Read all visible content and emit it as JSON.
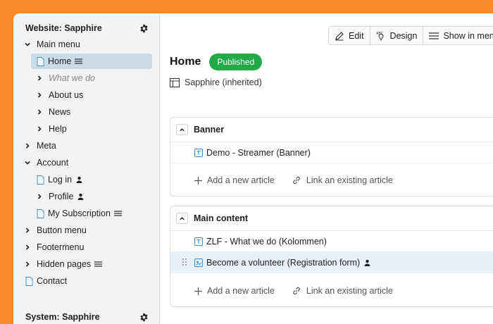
{
  "sidebar": {
    "website_title": "Website: Sapphire",
    "system_title": "System: Sapphire",
    "items": [
      {
        "label": "Main menu"
      },
      {
        "label": "Home"
      },
      {
        "label": "What we do"
      },
      {
        "label": "About us"
      },
      {
        "label": "News"
      },
      {
        "label": "Help"
      },
      {
        "label": "Meta"
      },
      {
        "label": "Account"
      },
      {
        "label": "Log in"
      },
      {
        "label": "Profile"
      },
      {
        "label": "My Subscription"
      },
      {
        "label": "Button menu"
      },
      {
        "label": "Footermenu"
      },
      {
        "label": "Hidden pages"
      },
      {
        "label": "Contact"
      }
    ]
  },
  "toolbar": {
    "edit_label": "Edit",
    "design_label": "Design",
    "show_in_menu_label": "Show in menu"
  },
  "page": {
    "title": "Home",
    "status": "Published",
    "template": "Sapphire (inherited)"
  },
  "blocks": [
    {
      "title": "Banner",
      "articles": [
        "Demo - Streamer (Banner)"
      ],
      "add_label": "Add a new article",
      "link_label": "Link an existing article"
    },
    {
      "title": "Main content",
      "articles": [
        "ZLF - What we do (Kolommen)",
        "Become a volunteer (Registration form)"
      ],
      "add_label": "Add a new article",
      "link_label": "Link an existing article"
    }
  ],
  "colors": {
    "background": "#f7892f",
    "selected": "#c9dbe7",
    "published": "#22a94a",
    "icon_blue": "#3b8fd1"
  }
}
